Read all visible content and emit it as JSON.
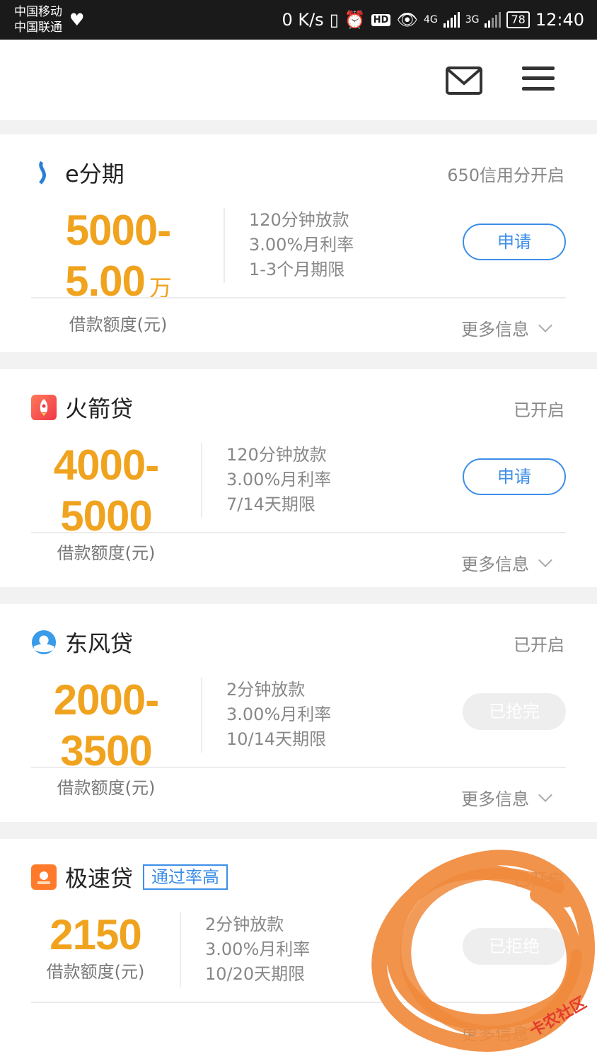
{
  "status_bar": {
    "carrier1": "中国移动",
    "carrier2": "中国联通",
    "speed": "0 K/s",
    "hd": "HD",
    "net1": "4G",
    "net2": "3G",
    "battery": "78",
    "time": "12:40"
  },
  "header": {
    "mail_icon": "mail-icon",
    "menu_icon": "hamburger-menu-icon"
  },
  "colors": {
    "accent": "#3c8ee8",
    "amount": "#f0a31e",
    "annotation": "#f08a3c"
  },
  "loans": [
    {
      "name": "e分期",
      "tag": "",
      "status": "650信用分开启",
      "amount": "5000-5.00",
      "amount_unit": "万",
      "amount_label": "借款额度(元)",
      "details": [
        "120分钟放款",
        "3.00%月利率",
        "1-3个月期限"
      ],
      "action": "申请",
      "action_enabled": true,
      "more": "更多信息"
    },
    {
      "name": "火箭贷",
      "tag": "",
      "status": "已开启",
      "amount": "4000-5000",
      "amount_unit": "",
      "amount_label": "借款额度(元)",
      "details": [
        "120分钟放款",
        "3.00%月利率",
        "7/14天期限"
      ],
      "action": "申请",
      "action_enabled": true,
      "more": "更多信息"
    },
    {
      "name": "东风贷",
      "tag": "",
      "status": "已开启",
      "amount": "2000-3500",
      "amount_unit": "",
      "amount_label": "借款额度(元)",
      "details": [
        "2分钟放款",
        "3.00%月利率",
        "10/14天期限"
      ],
      "action": "已抢完",
      "action_enabled": false,
      "more": "更多信息"
    },
    {
      "name": "极速贷",
      "tag": "通过率高",
      "status": "已开启",
      "amount": "2150",
      "amount_unit": "",
      "amount_label": "借款额度(元)",
      "details": [
        "2分钟放款",
        "3.00%月利率",
        "10/20天期限"
      ],
      "action": "已拒绝",
      "action_enabled": false,
      "more": "更多信息"
    }
  ],
  "watermark": "卡农社区"
}
